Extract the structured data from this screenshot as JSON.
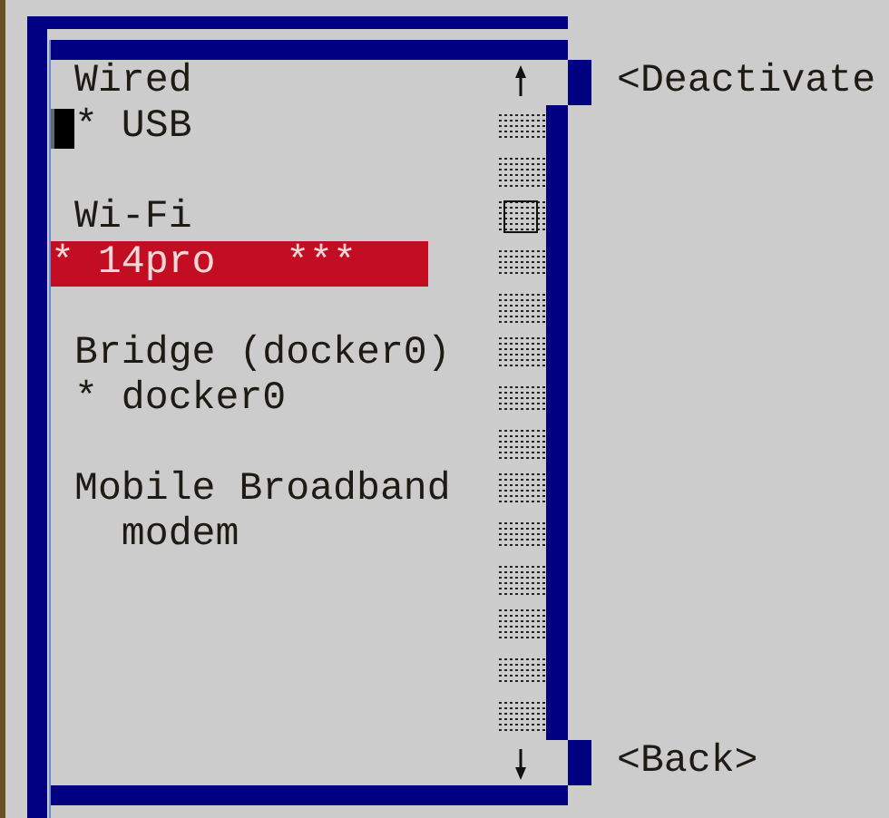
{
  "connection_list": {
    "sections": [
      {
        "title": "Wired",
        "items": [
          {
            "label": "* USB",
            "selected": false,
            "cursor": true
          }
        ]
      },
      {
        "title": "Wi-Fi",
        "items": [
          {
            "label": "* 14pro   ***",
            "selected": true,
            "cursor": false
          }
        ]
      },
      {
        "title": "Bridge (docker0)",
        "items": [
          {
            "label": "* docker0",
            "selected": false,
            "cursor": false
          }
        ]
      },
      {
        "title": "Mobile Broadband",
        "items": [
          {
            "label": "  modem",
            "selected": false,
            "cursor": false
          }
        ]
      }
    ]
  },
  "buttons": [
    {
      "label": "<Deactivate"
    },
    {
      "label": "<Back>"
    }
  ]
}
